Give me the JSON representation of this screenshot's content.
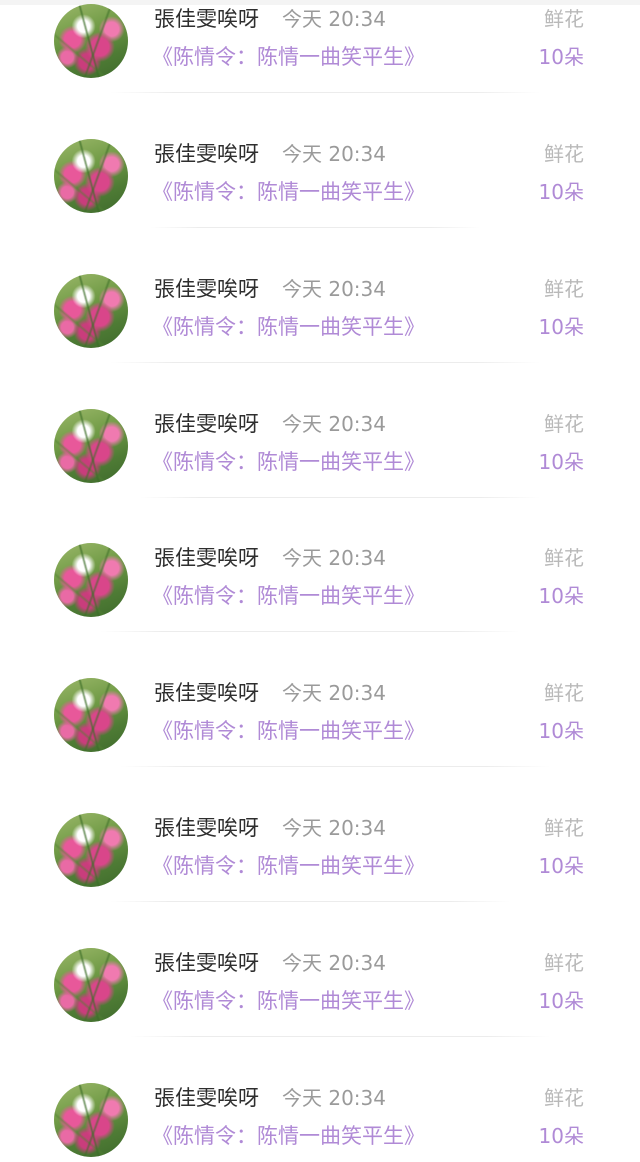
{
  "items": [
    {
      "name": "張佳雯唉呀",
      "time": "今天 20:34",
      "title": "《陈情令：陈情一曲笑平生》",
      "gift": "鲜花",
      "count": "10朵"
    },
    {
      "name": "張佳雯唉呀",
      "time": "今天 20:34",
      "title": "《陈情令：陈情一曲笑平生》",
      "gift": "鲜花",
      "count": "10朵"
    },
    {
      "name": "張佳雯唉呀",
      "time": "今天 20:34",
      "title": "《陈情令：陈情一曲笑平生》",
      "gift": "鲜花",
      "count": "10朵"
    },
    {
      "name": "張佳雯唉呀",
      "time": "今天 20:34",
      "title": "《陈情令：陈情一曲笑平生》",
      "gift": "鲜花",
      "count": "10朵"
    },
    {
      "name": "張佳雯唉呀",
      "time": "今天 20:34",
      "title": "《陈情令：陈情一曲笑平生》",
      "gift": "鲜花",
      "count": "10朵"
    },
    {
      "name": "張佳雯唉呀",
      "time": "今天 20:34",
      "title": "《陈情令：陈情一曲笑平生》",
      "gift": "鲜花",
      "count": "10朵"
    },
    {
      "name": "張佳雯唉呀",
      "time": "今天 20:34",
      "title": "《陈情令：陈情一曲笑平生》",
      "gift": "鲜花",
      "count": "10朵"
    },
    {
      "name": "張佳雯唉呀",
      "time": "今天 20:34",
      "title": "《陈情令：陈情一曲笑平生》",
      "gift": "鲜花",
      "count": "10朵"
    },
    {
      "name": "張佳雯唉呀",
      "time": "今天 20:34",
      "title": "《陈情令：陈情一曲笑平生》",
      "gift": "鲜花",
      "count": "10朵"
    }
  ],
  "colors": {
    "accent": "#b08ad6",
    "name_text": "#2e2e2e",
    "secondary_text": "#9a9a9a",
    "muted_text": "#b9b9b9"
  },
  "icons": {
    "avatar": "flower-photo-avatar"
  }
}
